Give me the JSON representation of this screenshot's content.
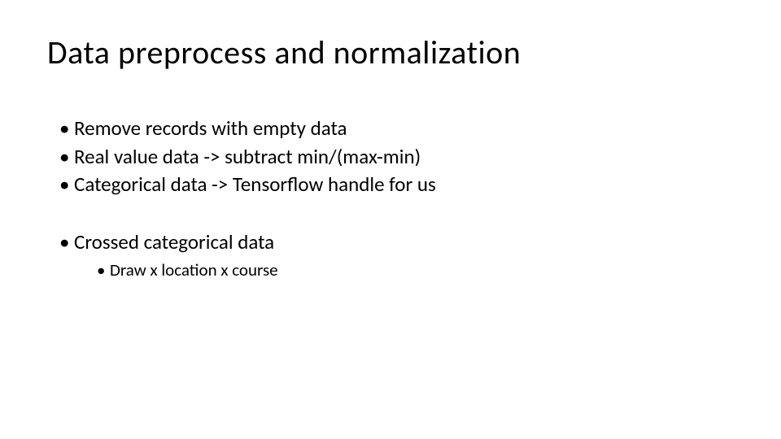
{
  "slide": {
    "title": "Data preprocess and normalization",
    "bullets_a": [
      "Remove records with empty data",
      "Real value data -> subtract min/(max-min)",
      "Categorical data -> Tensorflow handle for us"
    ],
    "bullets_b": [
      {
        "text": "Crossed categorical data",
        "sub": [
          "Draw x location x course"
        ]
      }
    ]
  }
}
